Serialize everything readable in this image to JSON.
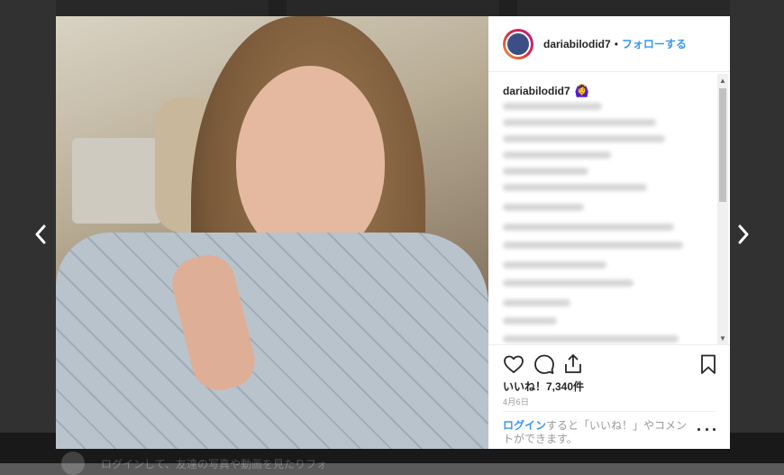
{
  "post": {
    "username": "dariabilodid7",
    "follow_separator": "•",
    "follow_label": "フォローする",
    "caption_user": "dariabilodid7",
    "caption_emoji": "🙆‍♀️",
    "likes_label": "いいね！7,340件",
    "date": "4月6日"
  },
  "login": {
    "link_label": "ログイン",
    "rest": "すると「いいね！」やコメントができます。"
  },
  "background": {
    "footer_text": "ログインして、友達の写真や動画を見たりフォ"
  },
  "icons": {
    "prev": "chevron-left-icon",
    "next": "chevron-right-icon",
    "like": "heart-icon",
    "comment": "comment-icon",
    "share": "share-icon",
    "save": "bookmark-icon",
    "more": "more-icon"
  },
  "colors": {
    "link_blue": "#3897f0",
    "text_dark": "#262626",
    "text_muted": "#999999"
  }
}
